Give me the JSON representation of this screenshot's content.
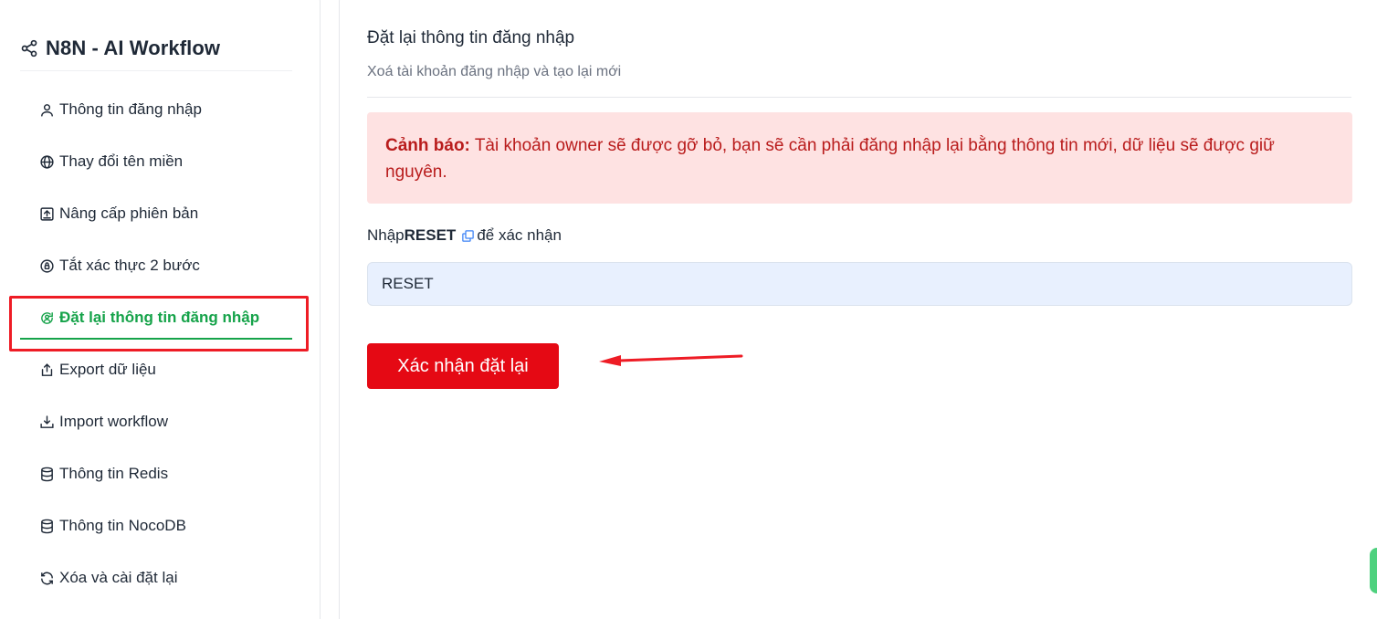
{
  "app": {
    "title": "N8N - AI Workflow"
  },
  "sidebar": {
    "items": [
      {
        "label": "Thông tin đăng nhập",
        "icon": "user-icon"
      },
      {
        "label": "Thay đổi tên miền",
        "icon": "globe-icon"
      },
      {
        "label": "Nâng cấp phiên bản",
        "icon": "upgrade-icon"
      },
      {
        "label": "Tắt xác thực 2 bước",
        "icon": "two-factor-icon"
      },
      {
        "label": "Đặt lại thông tin đăng nhập",
        "icon": "user-reset-icon",
        "active": true
      },
      {
        "label": "Export dữ liệu",
        "icon": "export-icon"
      },
      {
        "label": "Import workflow",
        "icon": "import-icon"
      },
      {
        "label": "Thông tin Redis",
        "icon": "database-icon"
      },
      {
        "label": "Thông tin NocoDB",
        "icon": "database-icon"
      },
      {
        "label": "Xóa và cài đặt lại",
        "icon": "refresh-icon"
      }
    ]
  },
  "main": {
    "title": "Đặt lại thông tin đăng nhập",
    "subtitle": "Xoá tài khoản đăng nhập và tạo lại mới",
    "warning": {
      "label": "Cảnh báo:",
      "text": "Tài khoản owner sẽ được gỡ bỏ, bạn sẽ cần phải đăng nhập lại bằng thông tin mới, dữ liệu sẽ được giữ nguyên."
    },
    "confirm": {
      "prefix": "Nhập",
      "keyword": "RESET",
      "suffix": "để xác nhận",
      "input_value": "RESET"
    },
    "submit_label": "Xác nhận đặt lại"
  },
  "colors": {
    "accent_green": "#16a34a",
    "danger_red": "#e50914",
    "warning_bg": "#fee2e2",
    "warning_text": "#b91c1c",
    "annotation_red": "#ee1c25"
  }
}
